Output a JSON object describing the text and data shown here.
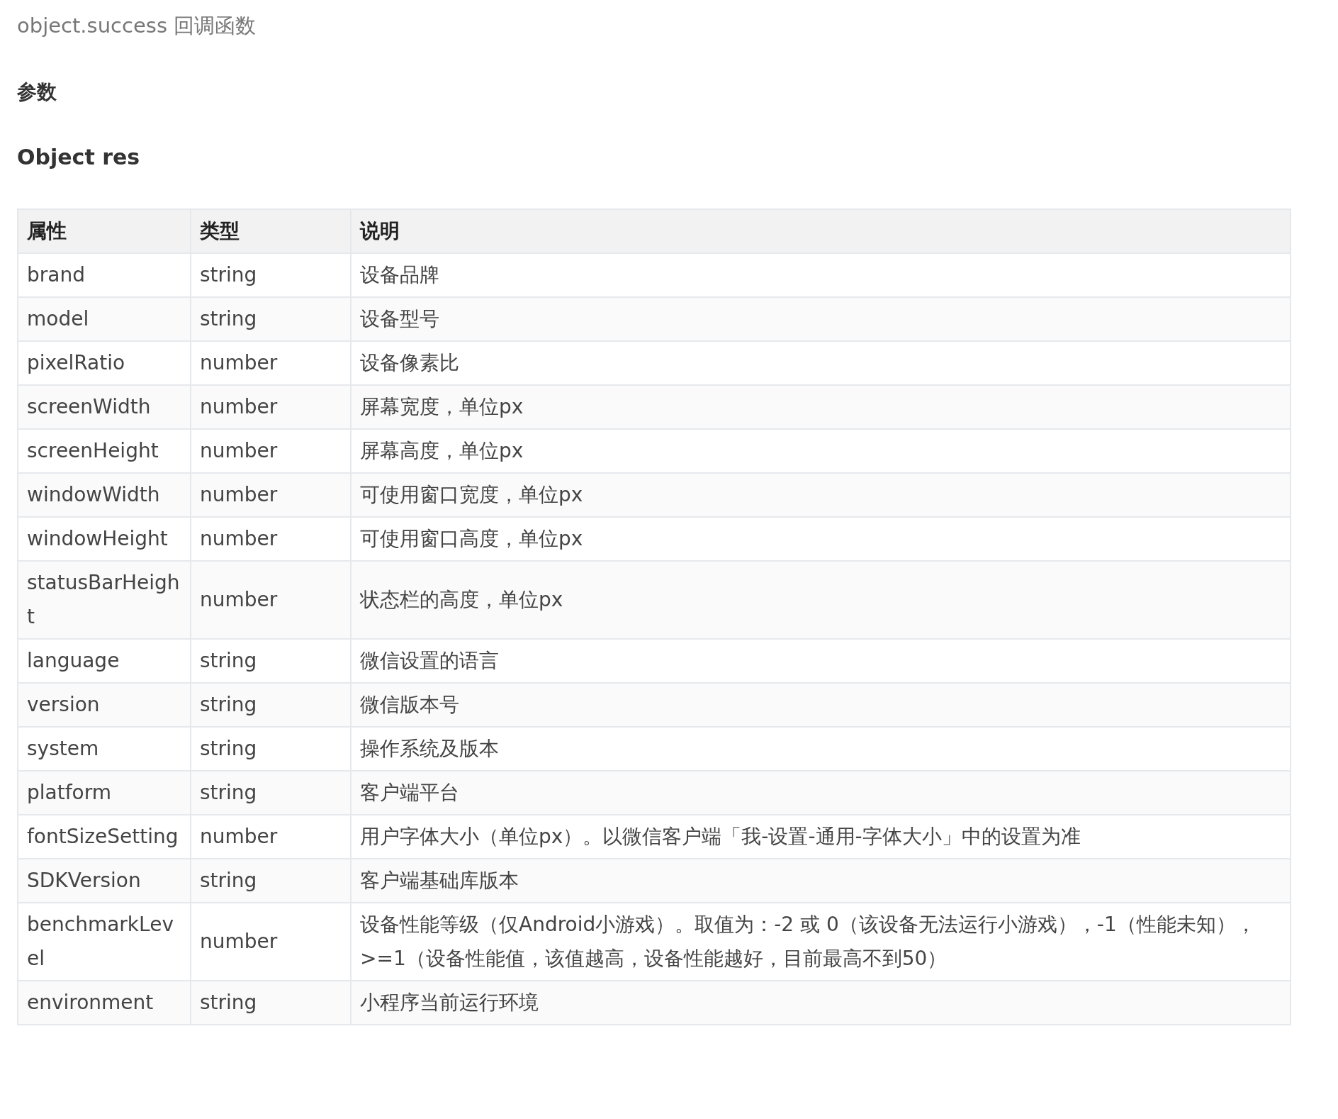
{
  "callback_title": "object.success 回调函数",
  "params_heading": "参数",
  "object_heading": "Object res",
  "table": {
    "columns": [
      "属性",
      "类型",
      "说明"
    ],
    "rows": [
      [
        "brand",
        "string",
        "设备品牌"
      ],
      [
        "model",
        "string",
        "设备型号"
      ],
      [
        "pixelRatio",
        "number",
        "设备像素比"
      ],
      [
        "screenWidth",
        "number",
        "屏幕宽度，单位px"
      ],
      [
        "screenHeight",
        "number",
        "屏幕高度，单位px"
      ],
      [
        "windowWidth",
        "number",
        "可使用窗口宽度，单位px"
      ],
      [
        "windowHeight",
        "number",
        "可使用窗口高度，单位px"
      ],
      [
        "statusBarHeight",
        "number",
        "状态栏的高度，单位px"
      ],
      [
        "language",
        "string",
        "微信设置的语言"
      ],
      [
        "version",
        "string",
        "微信版本号"
      ],
      [
        "system",
        "string",
        "操作系统及版本"
      ],
      [
        "platform",
        "string",
        "客户端平台"
      ],
      [
        "fontSizeSetting",
        "number",
        "用户字体大小（单位px）。以微信客户端「我-设置-通用-字体大小」中的设置为准"
      ],
      [
        "SDKVersion",
        "string",
        "客户端基础库版本"
      ],
      [
        "benchmarkLevel",
        "number",
        "设备性能等级（仅Android小游戏）。取值为：-2 或 0（该设备无法运行小游戏），-1（性能未知），>=1（设备性能值，该值越高，设备性能越好，目前最高不到50）"
      ],
      [
        "environment",
        "string",
        "小程序当前运行环境"
      ]
    ]
  }
}
